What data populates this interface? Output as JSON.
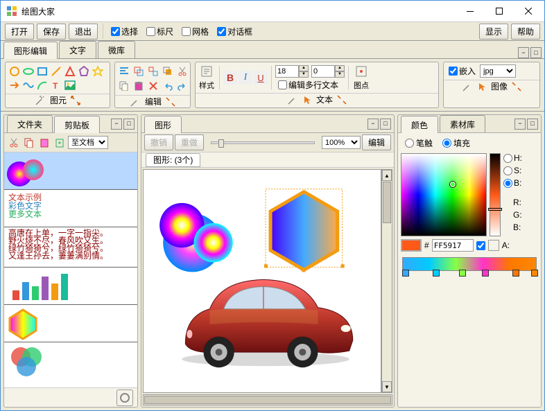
{
  "title": "绘图大家",
  "menubar": {
    "open": "打开",
    "save": "保存",
    "exit": "退出",
    "select": "选择",
    "ruler": "标尺",
    "grid": "网格",
    "dialog": "对话框",
    "display": "显示",
    "help": "帮助"
  },
  "maintabs": {
    "shape_edit": "图形编辑",
    "text": "文字",
    "lib": "微库"
  },
  "ribbon": {
    "primary": "图元",
    "edit": "编辑",
    "text": "文本",
    "image": "图像",
    "style": "样式",
    "point": "图点",
    "bold": "B",
    "italic": "I",
    "underline": "U",
    "font_size": "18",
    "spacing": "0",
    "multiline": "编辑多行文本",
    "embed": "嵌入",
    "format": "jpg"
  },
  "left": {
    "tab_folder": "文件夹",
    "tab_clipboard": "剪贴板",
    "to_doc": "至文档"
  },
  "mid": {
    "tab_canvas": "图形",
    "undo": "撤销",
    "redo": "重做",
    "zoom": "100%",
    "edit_btn": "编辑",
    "count_label": "图形: (3个)"
  },
  "right": {
    "tab_color": "颜色",
    "tab_material": "素材库",
    "brush": "笔触",
    "fill": "填充",
    "hex_prefix": "#",
    "hex_value": "FF5917",
    "ch": {
      "H": "H:",
      "S": "S:",
      "B": "B:",
      "R": "R:",
      "G": "G:",
      "Bl": "B:",
      "A": "A:"
    }
  }
}
